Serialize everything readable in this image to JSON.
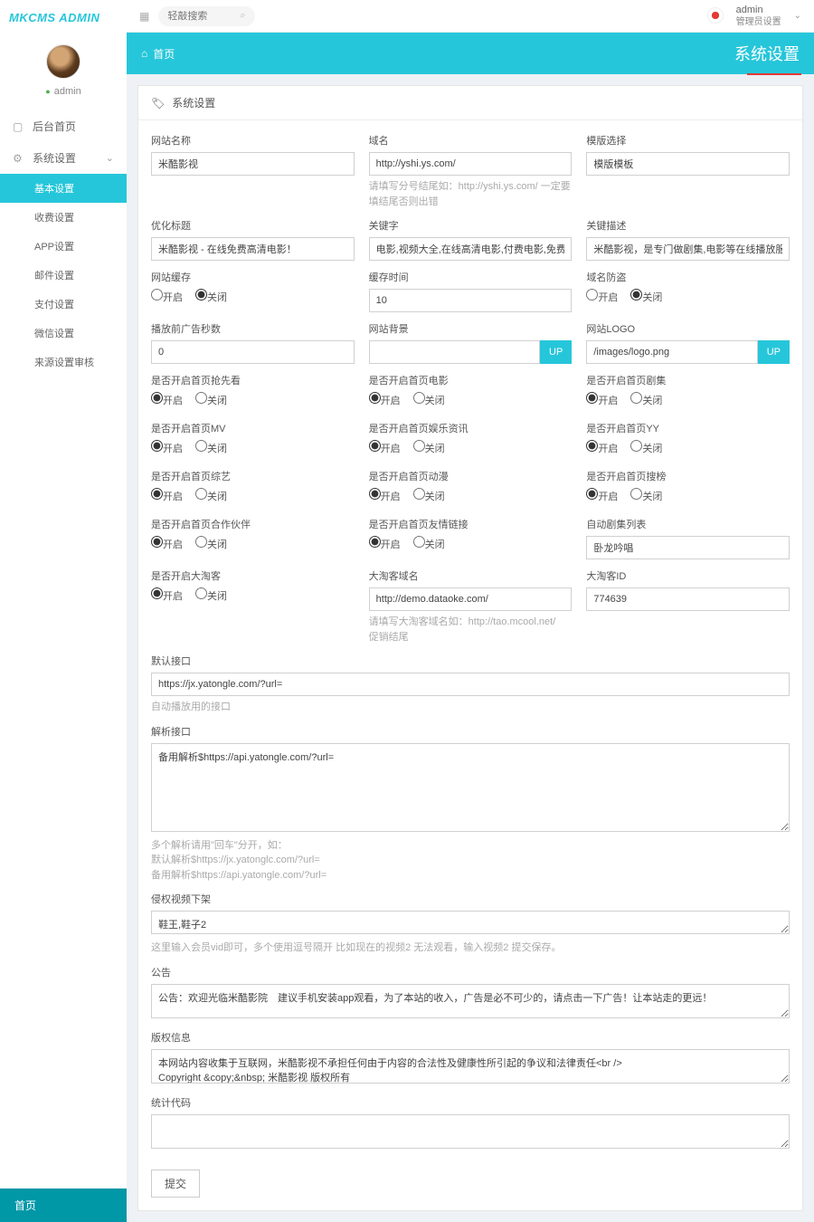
{
  "logo": "MKCMS ADMIN",
  "search": {
    "placeholder": "轻敲搜索"
  },
  "user": {
    "name": "admin",
    "role": "管理员设置"
  },
  "avatar_name": "admin",
  "crumb": {
    "home": "首页",
    "title": "系统设置"
  },
  "panel_title": "系统设置",
  "nav": [
    {
      "icon": "▢",
      "label": "后台首页",
      "sub": false
    },
    {
      "icon": "⚙",
      "label": "系统设置",
      "sub": false,
      "chev": true
    }
  ],
  "sub_nav": [
    "基本设置",
    "收费设置",
    "APP设置",
    "邮件设置",
    "支付设置",
    "微信设置",
    "来源设置审核"
  ],
  "footer_nav": "首页",
  "fields": {
    "site_name": {
      "label": "网站名称",
      "value": "米酷影视"
    },
    "domain": {
      "label": "域名",
      "value": "http://yshi.ys.com/",
      "hint": "请填写分号结尾如：http://yshi.ys.com/ 一定要填结尾否则出错"
    },
    "template": {
      "label": "模版选择",
      "value": "模版模板"
    },
    "seo_title": {
      "label": "优化标题",
      "value": "米酷影视 - 在线免费高清电影！"
    },
    "keywords": {
      "label": "关键字",
      "value": "电影,视频大全,在线高清电影,付费电影,免费电影,剧集,电影"
    },
    "description": {
      "label": "关键描述",
      "value": "米酷影视，是专门做剧集,电影等在线播放服务，本页面提供"
    },
    "cache": {
      "label": "网站缓存",
      "opts": [
        "开启",
        "关闭"
      ],
      "sel": 1
    },
    "cache_time": {
      "label": "缓存时间",
      "value": "10"
    },
    "antisteal": {
      "label": "域名防盗",
      "opts": [
        "开启",
        "关闭"
      ],
      "sel": 1
    },
    "ad_sec": {
      "label": "播放前广告秒数",
      "value": "0"
    },
    "bg": {
      "label": "网站背景",
      "value": ""
    },
    "logo": {
      "label": "网站LOGO",
      "value": "/images/logo.png"
    },
    "home_lead": {
      "label": "是否开启首页抢先看",
      "opts": [
        "开启",
        "关闭"
      ],
      "sel": 0
    },
    "home_movie": {
      "label": "是否开启首页电影",
      "opts": [
        "开启",
        "关闭"
      ],
      "sel": 0
    },
    "home_drama": {
      "label": "是否开启首页剧集",
      "opts": [
        "开启",
        "关闭"
      ],
      "sel": 0
    },
    "home_mv": {
      "label": "是否开启首页MV",
      "opts": [
        "开启",
        "关闭"
      ],
      "sel": 0
    },
    "home_yule": {
      "label": "是否开启首页娱乐资讯",
      "opts": [
        "开启",
        "关闭"
      ],
      "sel": 0
    },
    "home_yy": {
      "label": "是否开启首页YY",
      "opts": [
        "开启",
        "关闭"
      ],
      "sel": 0
    },
    "home_zongyi": {
      "label": "是否开启首页综艺",
      "opts": [
        "开启",
        "关闭"
      ],
      "sel": 0
    },
    "home_dongman": {
      "label": "是否开启首页动漫",
      "opts": [
        "开启",
        "关闭"
      ],
      "sel": 0
    },
    "home_souhang": {
      "label": "是否开启首页搜榜",
      "opts": [
        "开启",
        "关闭"
      ],
      "sel": 0
    },
    "home_partner": {
      "label": "是否开启首页合作伙伴",
      "opts": [
        "开启",
        "关闭"
      ],
      "sel": 0
    },
    "home_link": {
      "label": "是否开启首页友情链接",
      "opts": [
        "开启",
        "关闭"
      ],
      "sel": 0
    },
    "auto_list": {
      "label": "自动剧集列表",
      "value": "卧龙吟唱"
    },
    "dataoke": {
      "label": "是否开启大淘客",
      "opts": [
        "开启",
        "关闭"
      ],
      "sel": 0
    },
    "dataoke_domain": {
      "label": "大淘客域名",
      "value": "http://demo.dataoke.com/",
      "hint": "请填写大淘客域名如：http://tao.mcool.net/　　促销结尾"
    },
    "dataoke_id": {
      "label": "大淘客ID",
      "value": "774639"
    },
    "default_port": {
      "label": "默认接口",
      "value": "https://jx.yatongle.com/?url=",
      "hint": "自动播放用的接口"
    },
    "parse_port": {
      "label": "解析接口",
      "value": "备用解析$https://api.yatongle.com/?url=",
      "hint": "多个解析请用\"回车\"分开，如：\n默认解析$https://jx.yatonglc.com/?url=\n备用解析$https://api.yatongle.com/?url="
    },
    "ban_video": {
      "label": "侵权视频下架",
      "value": "鞋王,鞋子2",
      "hint": "这里输入会员vid即可，多个使用逗号隔开 比如现在的视频2 无法观看，输入视频2 提交保存。"
    },
    "notice": {
      "label": "公告",
      "value": "公告：欢迎光临米酷影院　建议手机安装app观看，为了本站的收入，广告是必不可少的，请点击一下广告！让本站走的更远！"
    },
    "copyright": {
      "label": "版权信息",
      "value": "本网站内容收集于互联网，米酷影视不承担任何由于内容的合法性及健康性所引起的争议和法律责任<br />\nCopyright &copy;&nbsp; 米酷影视 版权所有"
    },
    "stats": {
      "label": "统计代码",
      "value": ""
    }
  },
  "up_btn": "UP",
  "submit": "提交"
}
